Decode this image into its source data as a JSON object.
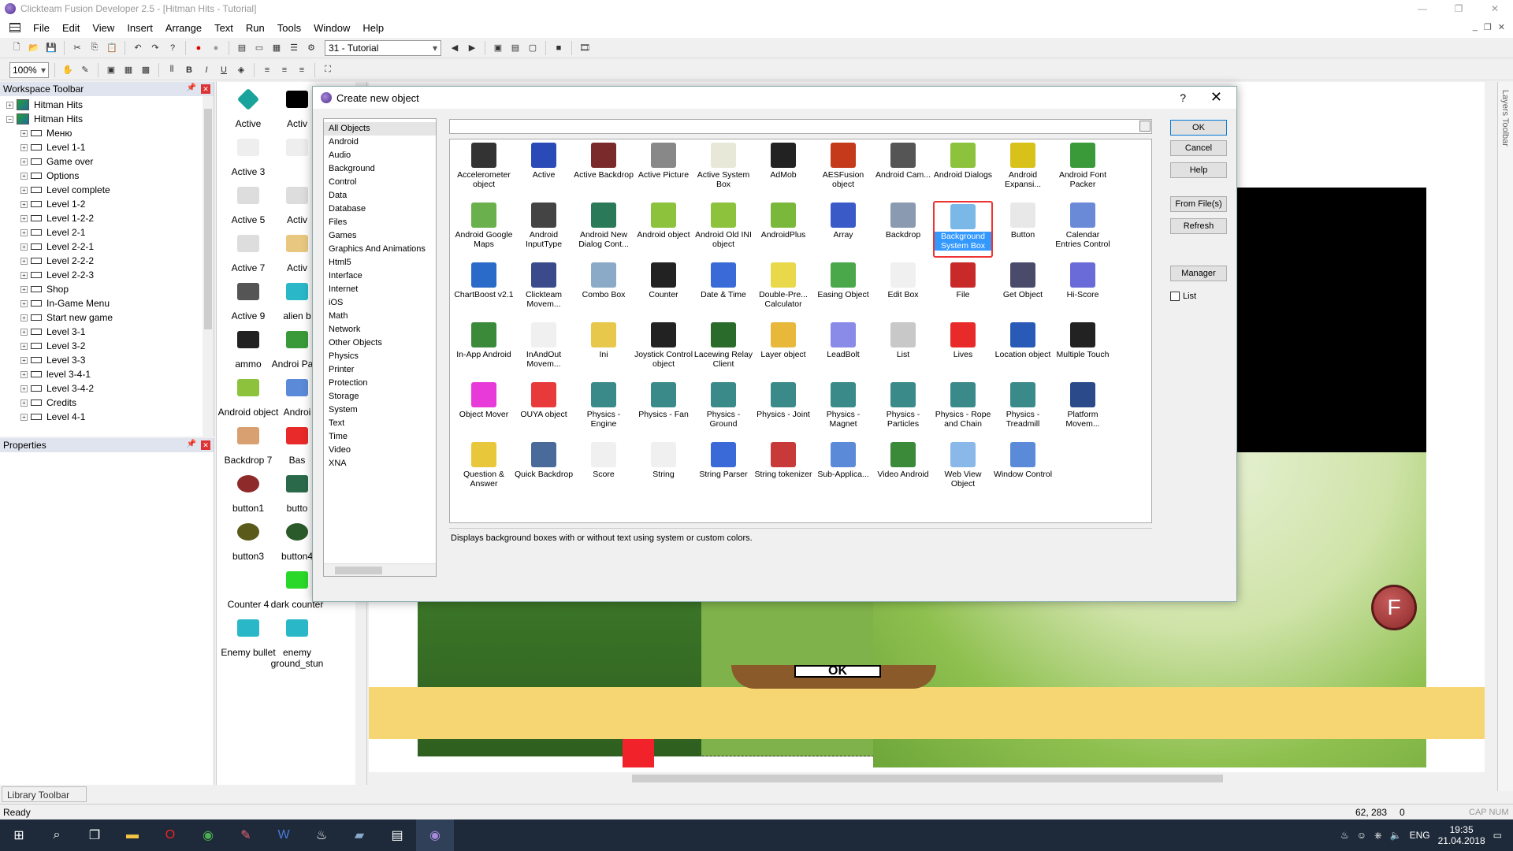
{
  "window": {
    "title": "Clickteam Fusion Developer 2.5 - [Hitman Hits - Tutorial]"
  },
  "menu": [
    "File",
    "Edit",
    "View",
    "Insert",
    "Arrange",
    "Text",
    "Run",
    "Tools",
    "Window",
    "Help"
  ],
  "toolbar": {
    "frame_selector": "31 - Tutorial",
    "zoom": "100%"
  },
  "workspace": {
    "title": "Workspace Toolbar",
    "tree": [
      {
        "label": "Hitman Hits",
        "type": "app"
      },
      {
        "label": "Hitman Hits",
        "type": "app"
      },
      {
        "label": "Меню",
        "type": "frame"
      },
      {
        "label": "Level 1-1",
        "type": "frame"
      },
      {
        "label": "Game over",
        "type": "frame"
      },
      {
        "label": "Options",
        "type": "frame"
      },
      {
        "label": "Level complete",
        "type": "frame"
      },
      {
        "label": "Level 1-2",
        "type": "frame"
      },
      {
        "label": "Level 1-2-2",
        "type": "frame"
      },
      {
        "label": "Level 2-1",
        "type": "frame"
      },
      {
        "label": "Level 2-2-1",
        "type": "frame"
      },
      {
        "label": "Level 2-2-2",
        "type": "frame"
      },
      {
        "label": "Level 2-2-3",
        "type": "frame"
      },
      {
        "label": "Shop",
        "type": "frame"
      },
      {
        "label": "In-Game Menu",
        "type": "frame"
      },
      {
        "label": "Start new game",
        "type": "frame"
      },
      {
        "label": "Level 3-1",
        "type": "frame"
      },
      {
        "label": "Level 3-2",
        "type": "frame"
      },
      {
        "label": "Level 3-3",
        "type": "frame"
      },
      {
        "label": "level 3-4-1",
        "type": "frame"
      },
      {
        "label": "Level 3-4-2",
        "type": "frame"
      },
      {
        "label": "Credits",
        "type": "frame"
      },
      {
        "label": "Level 4-1",
        "type": "frame"
      }
    ]
  },
  "properties": {
    "title": "Properties"
  },
  "object_list": [
    {
      "label": "Active",
      "col": 0
    },
    {
      "label": "Activ",
      "col": 1
    },
    {
      "label": "Active 3",
      "col": 0
    },
    {
      "label": "",
      "col": 1
    },
    {
      "label": "Active 5",
      "col": 0
    },
    {
      "label": "Activ",
      "col": 1
    },
    {
      "label": "Active 7",
      "col": 0
    },
    {
      "label": "Activ",
      "col": 1
    },
    {
      "label": "Active 9",
      "col": 0
    },
    {
      "label": "alien b",
      "col": 1
    },
    {
      "label": "ammo",
      "col": 0
    },
    {
      "label": "Androi Pack",
      "col": 1
    },
    {
      "label": "Android object",
      "col": 0
    },
    {
      "label": "Androi",
      "col": 1
    },
    {
      "label": "Backdrop 7",
      "col": 0
    },
    {
      "label": "Bas",
      "col": 1
    },
    {
      "label": "button1",
      "col": 0
    },
    {
      "label": "butto",
      "col": 1
    },
    {
      "label": "button3",
      "col": 0
    },
    {
      "label": "button4",
      "col": 1
    },
    {
      "label": "Counter 4",
      "col": 0
    },
    {
      "label": "dark counter",
      "col": 1
    },
    {
      "label": "Enemy bullet",
      "col": 0
    },
    {
      "label": "enemy ground_stun",
      "col": 1
    }
  ],
  "frame": {
    "sign_text": "OK",
    "button_f": "F"
  },
  "library": {
    "tab": "Library Toolbar"
  },
  "layers": {
    "title": "Layers Toolbar"
  },
  "status": {
    "ready": "Ready",
    "coords": "62, 283",
    "count": "0",
    "capnum": "CAP NUM"
  },
  "taskbar": {
    "lang": "ENG",
    "time": "19:35",
    "date": "21.04.2018"
  },
  "dialog": {
    "title": "Create new object",
    "help_label": "?",
    "categories": [
      "All Objects",
      "Android",
      "Audio",
      "Background",
      "Control",
      "Data",
      "Database",
      "Files",
      "Games",
      "Graphics And Animations",
      "Html5",
      "Interface",
      "Internet",
      "iOS",
      "Math",
      "Network",
      "Other Objects",
      "Physics",
      "Printer",
      "Protection",
      "Storage",
      "System",
      "Text",
      "Time",
      "Video",
      "XNA"
    ],
    "selected_category": "All Objects",
    "search_value": "",
    "buttons": {
      "ok": "OK",
      "cancel": "Cancel",
      "help": "Help",
      "from_files": "From File(s)",
      "refresh": "Refresh",
      "manager": "Manager",
      "list": "List"
    },
    "description": "Displays background boxes with or without text using system or custom colors.",
    "selected_object": "Background System Box",
    "objects": [
      {
        "label": "Accelerometer object",
        "color": "#333333"
      },
      {
        "label": "Active",
        "color": "#2a4ab8"
      },
      {
        "label": "Active Backdrop",
        "color": "#7a2a2a"
      },
      {
        "label": "Active Picture",
        "color": "#888888"
      },
      {
        "label": "Active System Box",
        "color": "#e8e8d8"
      },
      {
        "label": "AdMob",
        "color": "#222222"
      },
      {
        "label": "AESFusion object",
        "color": "#c43a1a"
      },
      {
        "label": "Android Cam...",
        "color": "#555555"
      },
      {
        "label": "Android Dialogs",
        "color": "#8cc23c"
      },
      {
        "label": "Android Expansi...",
        "color": "#d8c21a"
      },
      {
        "label": "Android Font Packer",
        "color": "#3a9a3a"
      },
      {
        "label": "Android Google Maps",
        "color": "#6ab04c"
      },
      {
        "label": "Android InputType",
        "color": "#444444"
      },
      {
        "label": "Android New Dialog Cont...",
        "color": "#2a7a5a"
      },
      {
        "label": "Android object",
        "color": "#8cc23c"
      },
      {
        "label": "Android Old INI object",
        "color": "#8cc23c"
      },
      {
        "label": "AndroidPlus",
        "color": "#7ab83c"
      },
      {
        "label": "Array",
        "color": "#3a5ac8"
      },
      {
        "label": "Backdrop",
        "color": "#8a9ab0"
      },
      {
        "label": "Background System Box",
        "color": "#7ab8e8"
      },
      {
        "label": "Button",
        "color": "#e8e8e8"
      },
      {
        "label": "Calendar Entries Control",
        "color": "#6a8ad8"
      },
      {
        "label": "ChartBoost v2.1",
        "color": "#2a6ac8"
      },
      {
        "label": "Clickteam Movem...",
        "color": "#3a4a8a"
      },
      {
        "label": "Combo Box",
        "color": "#8aaac8"
      },
      {
        "label": "Counter",
        "color": "#222222"
      },
      {
        "label": "Date & Time",
        "color": "#3a6ad8"
      },
      {
        "label": "Double-Pre... Calculator",
        "color": "#e8d84a"
      },
      {
        "label": "Easing Object",
        "color": "#4aa84a"
      },
      {
        "label": "Edit Box",
        "color": "#f0f0f0"
      },
      {
        "label": "File",
        "color": "#c82a2a"
      },
      {
        "label": "Get Object",
        "color": "#4a4a6a"
      },
      {
        "label": "Hi-Score",
        "color": "#6a6ad8"
      },
      {
        "label": "In-App Android",
        "color": "#3a8a3a"
      },
      {
        "label": "InAndOut Movem...",
        "color": "#f0f0f0"
      },
      {
        "label": "Ini",
        "color": "#e8c84a"
      },
      {
        "label": "Joystick Control object",
        "color": "#222222"
      },
      {
        "label": "Lacewing Relay Client",
        "color": "#2a6a2a"
      },
      {
        "label": "Layer object",
        "color": "#e8b83a"
      },
      {
        "label": "LeadBolt",
        "color": "#8a8ae8"
      },
      {
        "label": "List",
        "color": "#c8c8c8"
      },
      {
        "label": "Lives",
        "color": "#e82a2a"
      },
      {
        "label": "Location object",
        "color": "#2a5ab8"
      },
      {
        "label": "Multiple Touch",
        "color": "#222222"
      },
      {
        "label": "Object Mover",
        "color": "#e83ad8"
      },
      {
        "label": "OUYA object",
        "color": "#e83a3a"
      },
      {
        "label": "Physics - Engine",
        "color": "#3a8a8a"
      },
      {
        "label": "Physics - Fan",
        "color": "#3a8a8a"
      },
      {
        "label": "Physics - Ground",
        "color": "#3a8a8a"
      },
      {
        "label": "Physics - Joint",
        "color": "#3a8a8a"
      },
      {
        "label": "Physics - Magnet",
        "color": "#3a8a8a"
      },
      {
        "label": "Physics - Particles",
        "color": "#3a8a8a"
      },
      {
        "label": "Physics - Rope and Chain",
        "color": "#3a8a8a"
      },
      {
        "label": "Physics - Treadmill",
        "color": "#3a8a8a"
      },
      {
        "label": "Platform Movem...",
        "color": "#2a4a8a"
      },
      {
        "label": "Question & Answer",
        "color": "#e8c83a"
      },
      {
        "label": "Quick Backdrop",
        "color": "#4a6a9a"
      },
      {
        "label": "Score",
        "color": "#f0f0f0"
      },
      {
        "label": "String",
        "color": "#f0f0f0"
      },
      {
        "label": "String Parser",
        "color": "#3a6ad8"
      },
      {
        "label": "String tokenizer",
        "color": "#c83a3a"
      },
      {
        "label": "Sub-Applica...",
        "color": "#5a8ad8"
      },
      {
        "label": "Video Android",
        "color": "#3a8a3a"
      },
      {
        "label": "Web View Object",
        "color": "#8ab8e8"
      },
      {
        "label": "Window Control",
        "color": "#5a8ad8"
      }
    ]
  }
}
